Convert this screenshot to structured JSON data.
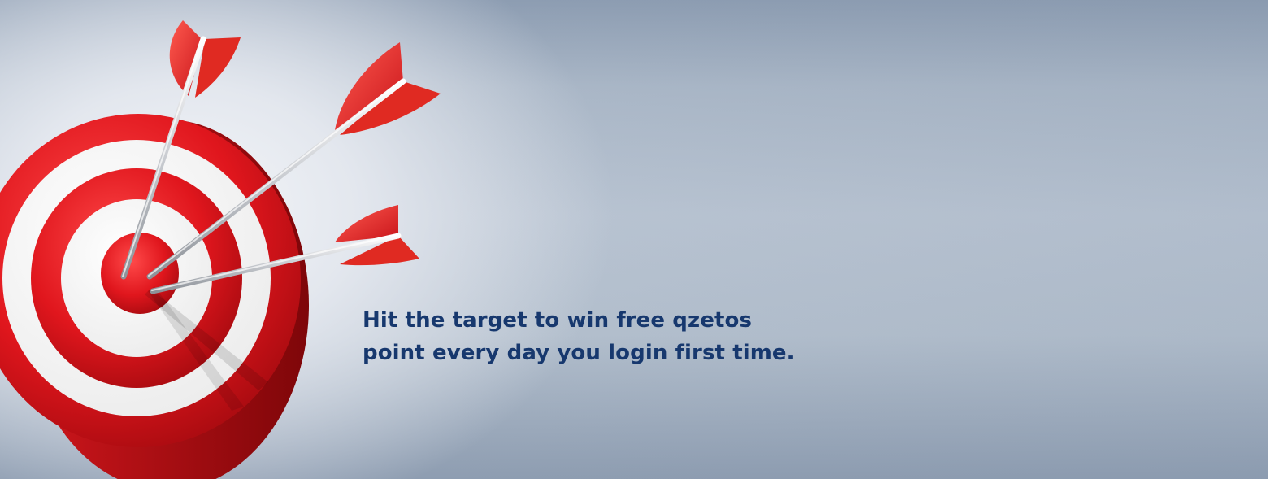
{
  "banner": {
    "headline_line1": "Hit the target to win free qzetos",
    "headline_line2": "point every day you login first time."
  },
  "colors": {
    "headline": "#17386e",
    "target_red": "#d9232a",
    "target_white": "#ffffff",
    "background": "#b9c4d2"
  },
  "icons": {
    "illustration": "target-with-arrows-icon"
  }
}
